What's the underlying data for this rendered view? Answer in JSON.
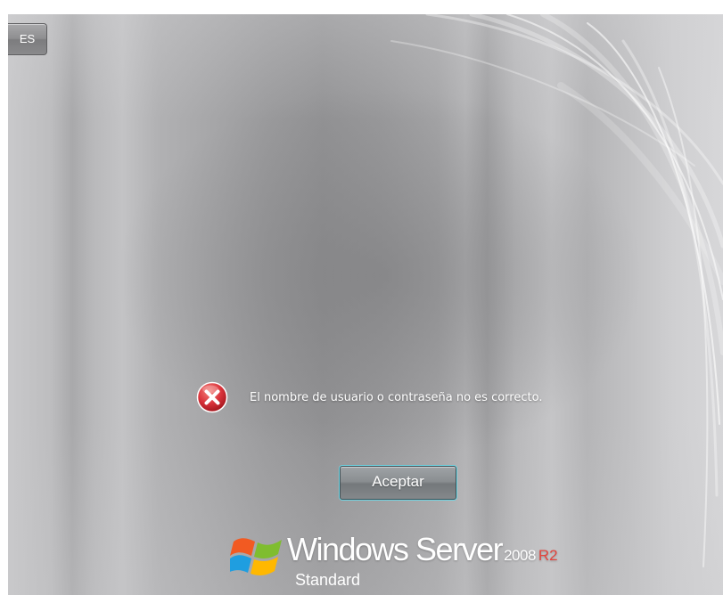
{
  "language_indicator": {
    "label": "ES"
  },
  "error": {
    "icon": "error-x-icon",
    "message": "El nombre de usuario o contraseña no es correcto."
  },
  "actions": {
    "ok_label": "Aceptar"
  },
  "branding": {
    "product": "Windows Server",
    "version": "2008",
    "release": "R2",
    "edition": "Standard",
    "logo_icon": "windows-flag-icon"
  },
  "colors": {
    "error_red": "#d9323a",
    "release_red": "#e2453e",
    "button_focus": "#6fd6e4",
    "text": "#ffffff"
  }
}
